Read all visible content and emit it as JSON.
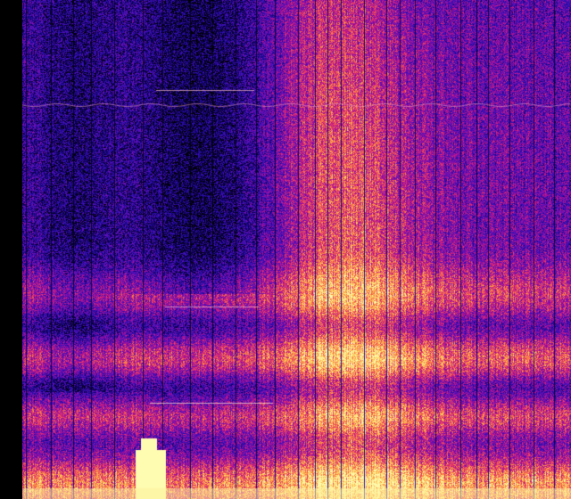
{
  "colormap": {
    "name": "magma-like",
    "stops": [
      "#000000",
      "#10005e",
      "#2a10b4",
      "#6a0fb8",
      "#b4108f",
      "#ec3e66",
      "#fb8d3d",
      "#fdd866",
      "#fefcb0"
    ]
  },
  "margin": {
    "color": "#000000"
  }
}
